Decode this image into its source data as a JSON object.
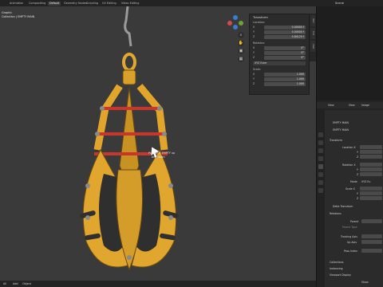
{
  "topbar": {
    "tabs": [
      "Animation",
      "Compositing",
      "Default",
      "Geometry Nodes",
      "Scripting",
      "UV Editing",
      "Video Editing"
    ],
    "active_tab": "Default",
    "scene_label": "Scene"
  },
  "viewport": {
    "overlay_line1": "Graphic",
    "overlay_line2": "Collection | EMPTY MAIN",
    "annotation_line1": "Put the X EMPTY up",
    "annotation_line2": "and down",
    "footer": {
      "mode": "Global",
      "buttons": [
        "Global"
      ]
    }
  },
  "npanel": {
    "title": "Transform",
    "location_label": "Location:",
    "location": [
      {
        "axis": "X",
        "value": "0.00000 f"
      },
      {
        "axis": "Y",
        "value": "0.00000 f"
      },
      {
        "axis": "Z",
        "value": "0.84120 f"
      }
    ],
    "rotation_label": "Rotation:",
    "rotation": [
      {
        "axis": "X",
        "value": "0°"
      },
      {
        "axis": "Y",
        "value": "0°"
      },
      {
        "axis": "Z",
        "value": "0°"
      }
    ],
    "rotation_mode": "XYZ Euler",
    "scale_label": "Scale:",
    "scale": [
      {
        "axis": "X",
        "value": "1.000"
      },
      {
        "axis": "Y",
        "value": "1.000"
      },
      {
        "axis": "Z",
        "value": "1.000"
      }
    ],
    "side_tabs": [
      "Item",
      "Tool",
      "View"
    ]
  },
  "right": {
    "header_items": [
      "View",
      "View",
      "Image"
    ],
    "object_name": "EMPTY MAIN",
    "object_name2": "EMPTY MAIN",
    "transform_section": "Transform",
    "location_x_label": "Location X",
    "location_y_label": "Y",
    "location_z_label": "Z",
    "rotation_x_label": "Rotation X",
    "rotation_y_label": "Y",
    "rotation_z_label": "Z",
    "mode_label": "Mode",
    "mode_value": "XYZ Eu",
    "scale_x_label": "Scale X",
    "scale_y_label": "Y",
    "scale_z_label": "Z",
    "delta_transform": "Delta Transform",
    "relations": "Relations",
    "parent_label": "Parent",
    "parent_type_label": "Parent Type",
    "tracking_axis_label": "Tracking Axis",
    "up_axis_label": "Up Axis",
    "pass_index_label": "Pass Index",
    "collections": "Collections",
    "instancing": "Instancing",
    "viewport_display": "Viewport Display",
    "show_label": "Show"
  },
  "statusbar": {
    "items": [
      "All",
      "Add",
      "Object"
    ]
  }
}
